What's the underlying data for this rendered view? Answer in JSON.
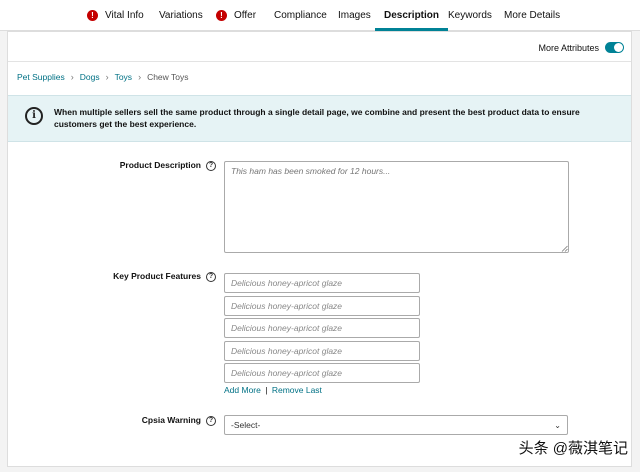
{
  "tabs": [
    {
      "label": "Vital Info",
      "error": true
    },
    {
      "label": "Variations",
      "error": false
    },
    {
      "label": "Offer",
      "error": true
    },
    {
      "label": "Compliance",
      "error": false
    },
    {
      "label": "Images",
      "error": false
    },
    {
      "label": "Description",
      "error": false,
      "active": true
    },
    {
      "label": "Keywords",
      "error": false
    },
    {
      "label": "More Details",
      "error": false
    }
  ],
  "header": {
    "more_attributes_label": "More Attributes",
    "more_attributes_on": true
  },
  "breadcrumb": {
    "items": [
      "Pet Supplies",
      "Dogs",
      "Toys"
    ],
    "current": "Chew Toys"
  },
  "info": {
    "text": "When multiple sellers sell the same product through a single detail page, we combine and present the best product data to ensure customers get the best experience."
  },
  "form": {
    "product_description": {
      "label": "Product Description",
      "placeholder": "This ham has been smoked for 12 hours..."
    },
    "key_features": {
      "label": "Key Product Features",
      "placeholders": [
        "Delicious honey-apricot glaze",
        "Delicious honey-apricot glaze",
        "Delicious honey-apricot glaze",
        "Delicious honey-apricot glaze",
        "Delicious honey-apricot glaze"
      ],
      "add_more": "Add More",
      "separator": "|",
      "remove_last": "Remove Last"
    },
    "cpsia_warning": {
      "label": "Cpsia Warning",
      "selected": "-Select-"
    }
  },
  "watermark": "头条 @薇淇笔记",
  "colors": {
    "accent": "#008296",
    "link": "#007185",
    "error": "#c40000",
    "info_bg": "#e6f3f5"
  }
}
